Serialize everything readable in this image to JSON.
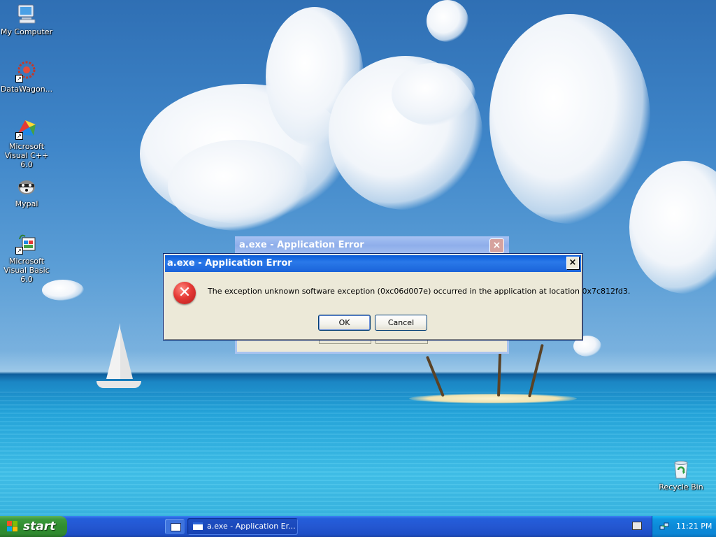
{
  "desktop": {
    "icons": [
      {
        "label": "My Computer",
        "icon": "computer-icon"
      },
      {
        "label": "DataWagon...",
        "icon": "datawagon-icon"
      },
      {
        "label": "Microsoft Visual C++ 6.0",
        "icon": "visual-cpp-icon"
      },
      {
        "label": "Mypal",
        "icon": "mypal-icon"
      },
      {
        "label": "Microsoft Visual Basic 6.0",
        "icon": "visual-basic-icon"
      }
    ],
    "recycle_bin": {
      "label": "Recycle Bin",
      "icon": "recycle-bin-icon"
    }
  },
  "background_dialog": {
    "title": "a.exe - Application Error",
    "close_glyph": "×"
  },
  "dialog": {
    "title": "a.exe - Application Error",
    "close_glyph": "×",
    "icon": "error-icon",
    "error_glyph": "✕",
    "message": "The exception unknown software exception (0xc06d007e) occurred in the application at location 0x7c812fd3.",
    "ok_label": "OK",
    "cancel_label": "Cancel"
  },
  "taskbar": {
    "start_label": "start",
    "quick_launch_icon": "show-desktop-icon",
    "task_label": "a.exe - Application Er...",
    "keyboard_icon": "keyboard-icon",
    "tray_icon": "network-icon",
    "clock": "11:21 PM"
  },
  "colors": {
    "titlebar_active": "#0a5cd8",
    "titlebar_inactive": "#a7c2f3",
    "dialog_face": "#ece9d8",
    "start_green": "#3c9a3c",
    "taskbar_blue": "#245edb"
  }
}
